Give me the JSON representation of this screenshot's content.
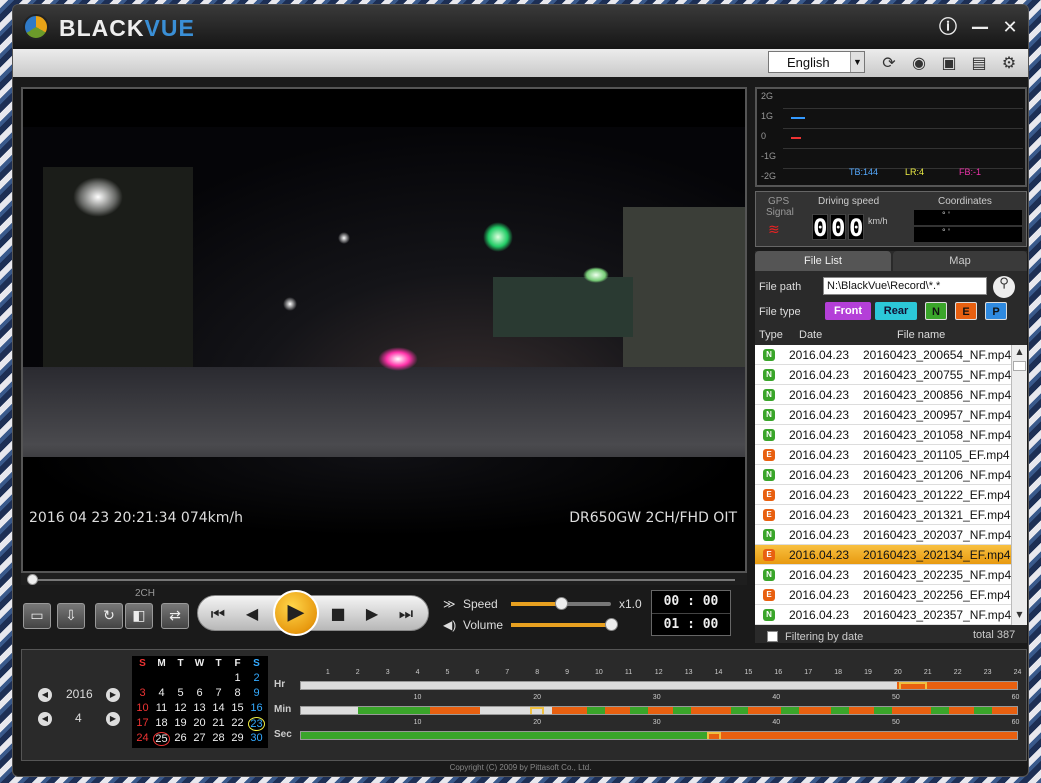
{
  "app": {
    "title_a": "BLACK",
    "title_b": "VUE"
  },
  "window_buttons": {
    "info": "ⓘ",
    "minimize": "—",
    "close": "✕"
  },
  "toolbar": {
    "language": "English"
  },
  "osd": {
    "left": "2016 04 23  20:21:34   074km/h",
    "right": "DR650GW 2CH/FHD OIT"
  },
  "gsensor": {
    "y_labels": [
      "2G",
      "1G",
      "0",
      "-1G",
      "-2G"
    ],
    "tb": "TB:144",
    "lr": "LR:4",
    "fb": "FB:-1"
  },
  "gps": {
    "label1": "GPS",
    "label2": "Signal",
    "speed_label": "Driving speed",
    "speed_digits": [
      "0",
      "0",
      "0"
    ],
    "unit": "km/h",
    "coord_label": "Coordinates",
    "coord1": "°     '",
    "coord2": "°     '"
  },
  "filelist": {
    "tab_list": "File List",
    "tab_map": "Map",
    "path_label": "File path",
    "path": "N:\\BlackVue\\Record\\*.*",
    "type_label": "File type",
    "types": {
      "front": "Front",
      "rear": "Rear",
      "n": "N",
      "e": "E",
      "p": "P"
    },
    "columns": {
      "type": "Type",
      "date": "Date",
      "name": "File name"
    },
    "rows": [
      {
        "t": "N",
        "date": "2016.04.23",
        "name": "20160423_200654_NF.mp4"
      },
      {
        "t": "N",
        "date": "2016.04.23",
        "name": "20160423_200755_NF.mp4"
      },
      {
        "t": "N",
        "date": "2016.04.23",
        "name": "20160423_200856_NF.mp4"
      },
      {
        "t": "N",
        "date": "2016.04.23",
        "name": "20160423_200957_NF.mp4"
      },
      {
        "t": "N",
        "date": "2016.04.23",
        "name": "20160423_201058_NF.mp4"
      },
      {
        "t": "E",
        "date": "2016.04.23",
        "name": "20160423_201105_EF.mp4"
      },
      {
        "t": "N",
        "date": "2016.04.23",
        "name": "20160423_201206_NF.mp4"
      },
      {
        "t": "E",
        "date": "2016.04.23",
        "name": "20160423_201222_EF.mp4"
      },
      {
        "t": "E",
        "date": "2016.04.23",
        "name": "20160423_201321_EF.mp4"
      },
      {
        "t": "N",
        "date": "2016.04.23",
        "name": "20160423_202037_NF.mp4"
      },
      {
        "t": "E",
        "date": "2016.04.23",
        "name": "20160423_202134_EF.mp4"
      },
      {
        "t": "N",
        "date": "2016.04.23",
        "name": "20160423_202235_NF.mp4"
      },
      {
        "t": "E",
        "date": "2016.04.23",
        "name": "20160423_202256_EF.mp4"
      },
      {
        "t": "N",
        "date": "2016.04.23",
        "name": "20160423_202357_NF.mp4"
      }
    ],
    "selected_index": 10,
    "filter_label": "Filtering by date",
    "total": "total 387"
  },
  "controls": {
    "ch2": "2CH",
    "speed_label": "Speed",
    "speed_value": "x1.0",
    "speed_fraction": 0.5,
    "volume_label": "Volume",
    "volume_fraction": 1.0,
    "time_current": "00 : 00",
    "time_total": "01 : 00"
  },
  "calendar": {
    "year": "2016",
    "month": "4",
    "headers": [
      "S",
      "M",
      "T",
      "W",
      "T",
      "F",
      "S"
    ],
    "weeks": [
      [
        "",
        "",
        "",
        "",
        "",
        "1",
        "2"
      ],
      [
        "3",
        "4",
        "5",
        "6",
        "7",
        "8",
        "9"
      ],
      [
        "10",
        "11",
        "12",
        "13",
        "14",
        "15",
        "16"
      ],
      [
        "17",
        "18",
        "19",
        "20",
        "21",
        "22",
        "23"
      ],
      [
        "24",
        "25",
        "26",
        "27",
        "28",
        "29",
        "30"
      ]
    ],
    "today": "25",
    "selected": "23"
  },
  "timeline": {
    "hr_label": "Hr",
    "min_label": "Min",
    "sec_label": "Sec",
    "hr_ticks": [
      "1",
      "2",
      "3",
      "4",
      "5",
      "6",
      "7",
      "8",
      "9",
      "10",
      "11",
      "12",
      "13",
      "14",
      "15",
      "16",
      "17",
      "18",
      "19",
      "20",
      "21",
      "22",
      "23",
      "24"
    ],
    "min_ticks": [
      "10",
      "20",
      "30",
      "40",
      "50",
      "60"
    ],
    "sec_ticks": [
      "10",
      "20",
      "30",
      "40",
      "50",
      "60"
    ],
    "colors": {
      "normal": "#3aa52a",
      "event": "#e86010",
      "empty": "#dddddd",
      "select": "#f0c040"
    }
  },
  "footer": "Copyright (C) 2009 by Pittasoft Co., Ltd."
}
